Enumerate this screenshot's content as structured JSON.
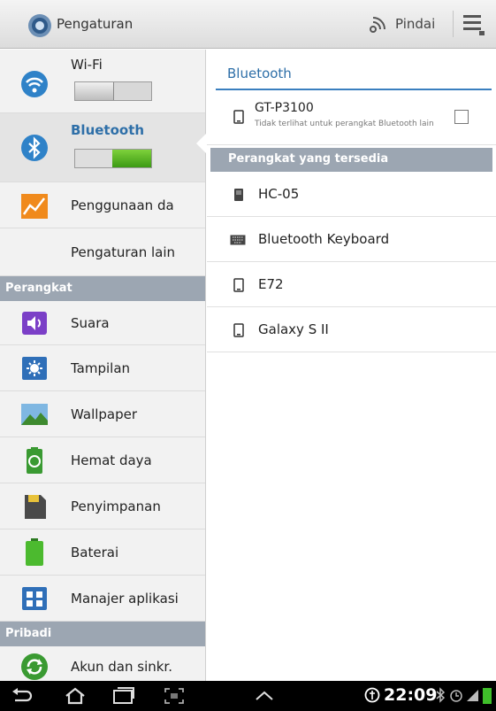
{
  "header": {
    "title": "Pengaturan",
    "scan_label": "Pindai"
  },
  "sidebar": {
    "items": [
      {
        "label": "Wi-Fi",
        "icon": "wifi-icon",
        "toggle": "off"
      },
      {
        "label": "Bluetooth",
        "icon": "bluetooth-icon",
        "toggle": "on",
        "selected": true
      },
      {
        "label": "Penggunaan da",
        "icon": "data-usage-icon"
      },
      {
        "label": "Pengaturan lain",
        "icon": ""
      }
    ],
    "section_device": "Perangkat",
    "device_items": [
      {
        "label": "Suara",
        "icon": "sound-icon"
      },
      {
        "label": "Tampilan",
        "icon": "display-icon"
      },
      {
        "label": "Wallpaper",
        "icon": "wallpaper-icon"
      },
      {
        "label": "Hemat daya",
        "icon": "power-saving-icon"
      },
      {
        "label": "Penyimpanan",
        "icon": "storage-icon"
      },
      {
        "label": "Baterai",
        "icon": "battery-icon"
      },
      {
        "label": "Manajer aplikasi",
        "icon": "app-manager-icon"
      }
    ],
    "section_personal": "Pribadi",
    "personal_items": [
      {
        "label": "Akun dan sinkr.",
        "icon": "sync-icon"
      }
    ]
  },
  "bluetooth": {
    "title": "Bluetooth",
    "self_device": {
      "name": "GT-P3100",
      "subtitle": "Tidak terlihat untuk perangkat Bluetooth lain",
      "visible": false
    },
    "section_available": "Perangkat yang tersedia",
    "devices": [
      {
        "name": "HC-05",
        "icon": "device-icon"
      },
      {
        "name": "Bluetooth Keyboard",
        "icon": "keyboard-icon"
      },
      {
        "name": "E72",
        "icon": "phone-icon"
      },
      {
        "name": "Galaxy S II",
        "icon": "phone-icon"
      }
    ]
  },
  "status_bar": {
    "time": "22:09"
  },
  "colors": {
    "accent": "#2e6fa8",
    "section_header": "#9ca6b2",
    "toggle_on": "#4caf1f"
  }
}
